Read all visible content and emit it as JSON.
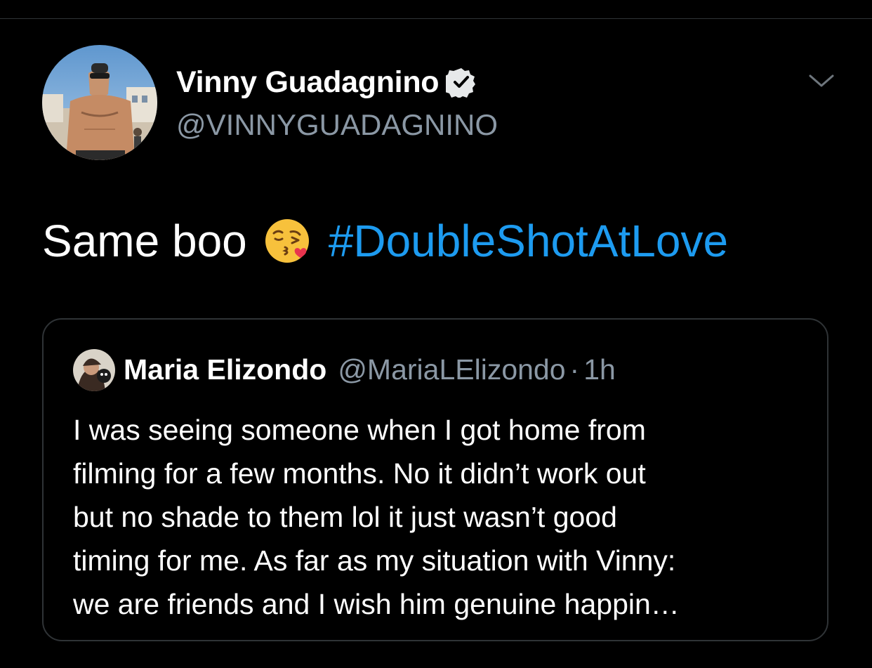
{
  "tweet": {
    "author": {
      "display_name": "Vinny Guadagnino",
      "handle": "@VINNYGUADAGNINO",
      "verified": true
    },
    "text": "Same boo",
    "emoji": "kissing-face-with-heart-emoji",
    "hashtag": "#DoubleShotAtLove",
    "menu_icon": "chevron-down-icon"
  },
  "quoted_tweet": {
    "author": {
      "display_name": "Maria Elizondo",
      "handle": "@MariaLElizondo"
    },
    "separator": "·",
    "time": "1h",
    "lines": [
      "I was seeing someone when I got home from",
      "filming for a few months. No it didn’t work out",
      "but no shade to them lol it just wasn’t good",
      "timing for me. As far as my situation with Vinny:",
      "we are friends and I wish him genuine happin…"
    ]
  },
  "colors": {
    "background": "#000000",
    "text_primary": "#ffffff",
    "text_secondary": "#8b98a5",
    "link": "#1d9bf0",
    "border": "#2f3336"
  }
}
